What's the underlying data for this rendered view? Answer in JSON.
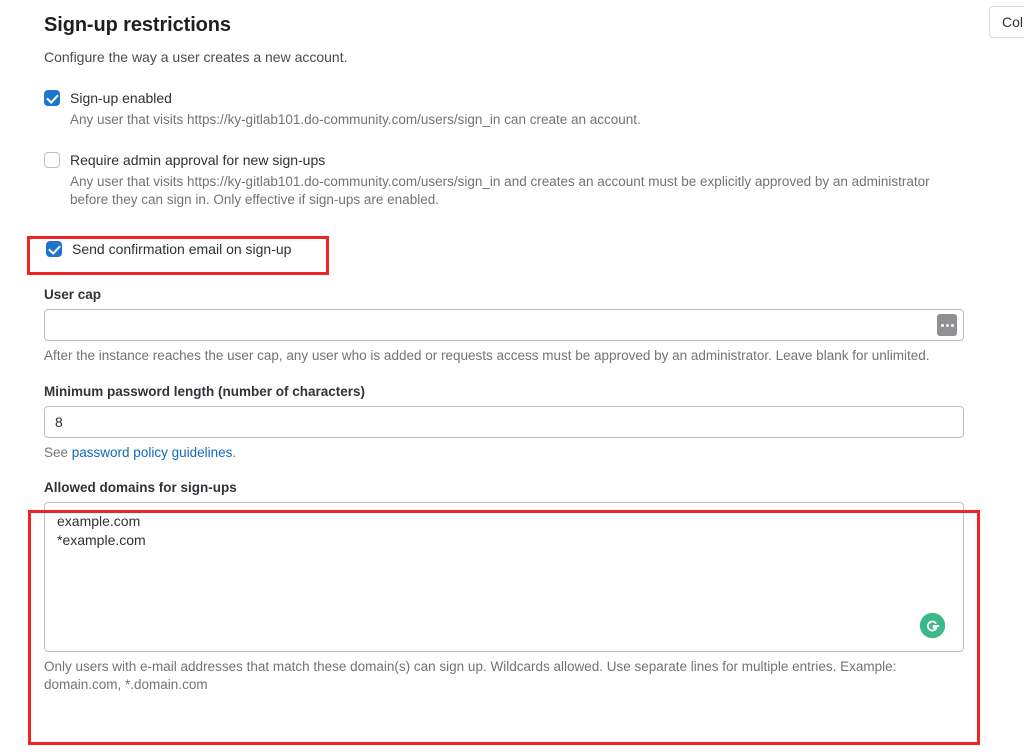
{
  "header": {
    "title": "Sign-up restrictions",
    "subtitle": "Configure the way a user creates a new account."
  },
  "top_right": {
    "collapse_button_label": "Col"
  },
  "checkboxes": [
    {
      "label": "Sign-up enabled",
      "checked": true,
      "help": "Any user that visits https://ky-gitlab101.do-community.com/users/sign_in can create an account."
    },
    {
      "label": "Require admin approval for new sign-ups",
      "checked": false,
      "help": "Any user that visits https://ky-gitlab101.do-community.com/users/sign_in and creates an account must be explicitly approved by an administrator before they can sign in. Only effective if sign-ups are enabled."
    },
    {
      "label": "Send confirmation email on sign-up",
      "checked": true,
      "help": ""
    }
  ],
  "user_cap": {
    "label": "User cap",
    "value": "",
    "placeholder": "",
    "icon": "password-manager-icon",
    "help": "After the instance reaches the user cap, any user who is added or requests access must be approved by an administrator. Leave blank for unlimited."
  },
  "min_password_length": {
    "label": "Minimum password length (number of characters)",
    "value": "8",
    "help_prefix": "See ",
    "help_link": "password policy guidelines",
    "help_suffix": "."
  },
  "allowed_domains": {
    "label": "Allowed domains for sign-ups",
    "value": "example.com\n*example.com",
    "icon": "grammarly-icon",
    "help": "Only users with e-mail addresses that match these domain(s) can sign up. Wildcards allowed. Use separate lines for multiple entries. Example: domain.com, *.domain.com"
  },
  "annotations": {
    "highlight_color": "#ef2525",
    "boxes": [
      {
        "name": "send-confirmation-email-highlight"
      },
      {
        "name": "allowed-domains-highlight"
      }
    ]
  },
  "colors": {
    "accent": "#1f75cb",
    "link": "#1068bf",
    "text": "#303030",
    "muted": "#737278",
    "grammarly_green": "#3cb98a"
  }
}
